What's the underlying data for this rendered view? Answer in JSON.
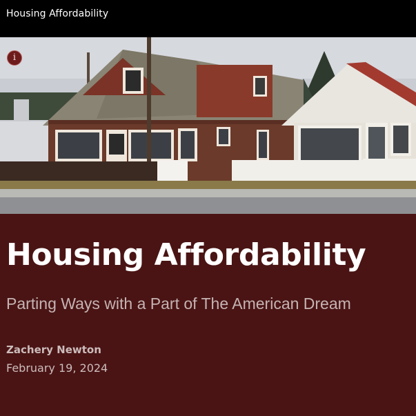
{
  "topbar": {
    "title": "Housing Affordability"
  },
  "hero": {
    "image_description_icon": "info-icon",
    "info_glyph": "i"
  },
  "article": {
    "headline": "Housing Affordability",
    "subheadline": "Parting Ways with a Part of The American Dream",
    "author": "Zachery Newton",
    "date": "February 19, 2024"
  },
  "colors": {
    "topbar": "#000000",
    "content_background": "#4a1414",
    "headline": "#ffffff",
    "subheadline": "#c6b3b3",
    "info_button": "#6e1b1b"
  }
}
